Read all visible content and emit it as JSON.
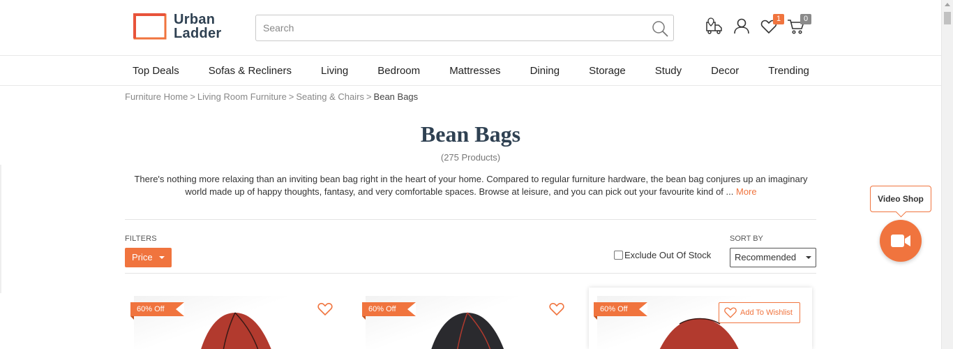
{
  "brand": {
    "line1": "Urban",
    "line2": "Ladder",
    "accent": "#f0743e",
    "navy": "#2f4152"
  },
  "search": {
    "placeholder": "Search"
  },
  "header_icons": [
    {
      "name": "track-order-icon"
    },
    {
      "name": "account-icon"
    },
    {
      "name": "wishlist-icon",
      "badge": "1"
    },
    {
      "name": "cart-icon",
      "badge": "0"
    }
  ],
  "nav": [
    "Top Deals",
    "Sofas & Recliners",
    "Living",
    "Bedroom",
    "Mattresses",
    "Dining",
    "Storage",
    "Study",
    "Decor",
    "Trending"
  ],
  "breadcrumb": {
    "items": [
      "Furniture Home",
      "Living Room Furniture",
      "Seating & Chairs"
    ],
    "current": "Bean Bags",
    "separator": ">"
  },
  "page": {
    "title": "Bean Bags",
    "count": "(275 Products)",
    "description": "There's nothing more relaxing than an inviting bean bag right in the heart of your home. Compared to regular furniture hardware, the bean bag conjures up an imaginary world made up of happy thoughts, fantasy, and very comfortable spaces. Browse at leisure, and you can pick out your favourite kind of ...",
    "more": "More"
  },
  "filters": {
    "label": "FILTERS",
    "price": "Price",
    "exclude_label": "Exclude Out Of Stock",
    "exclude_checked": false,
    "sort_label": "SORT BY",
    "sort_value": "Recommended"
  },
  "products": [
    {
      "discount": "60% Off",
      "bag_color": "#b23a2e"
    },
    {
      "discount": "60% Off",
      "bag_color": "#2a2a2e"
    },
    {
      "discount": "60% Off",
      "bag_color": "#b23a2e",
      "wishlist_label": "Add To Wishlist"
    }
  ],
  "video_shop": {
    "label": "Video Shop"
  }
}
